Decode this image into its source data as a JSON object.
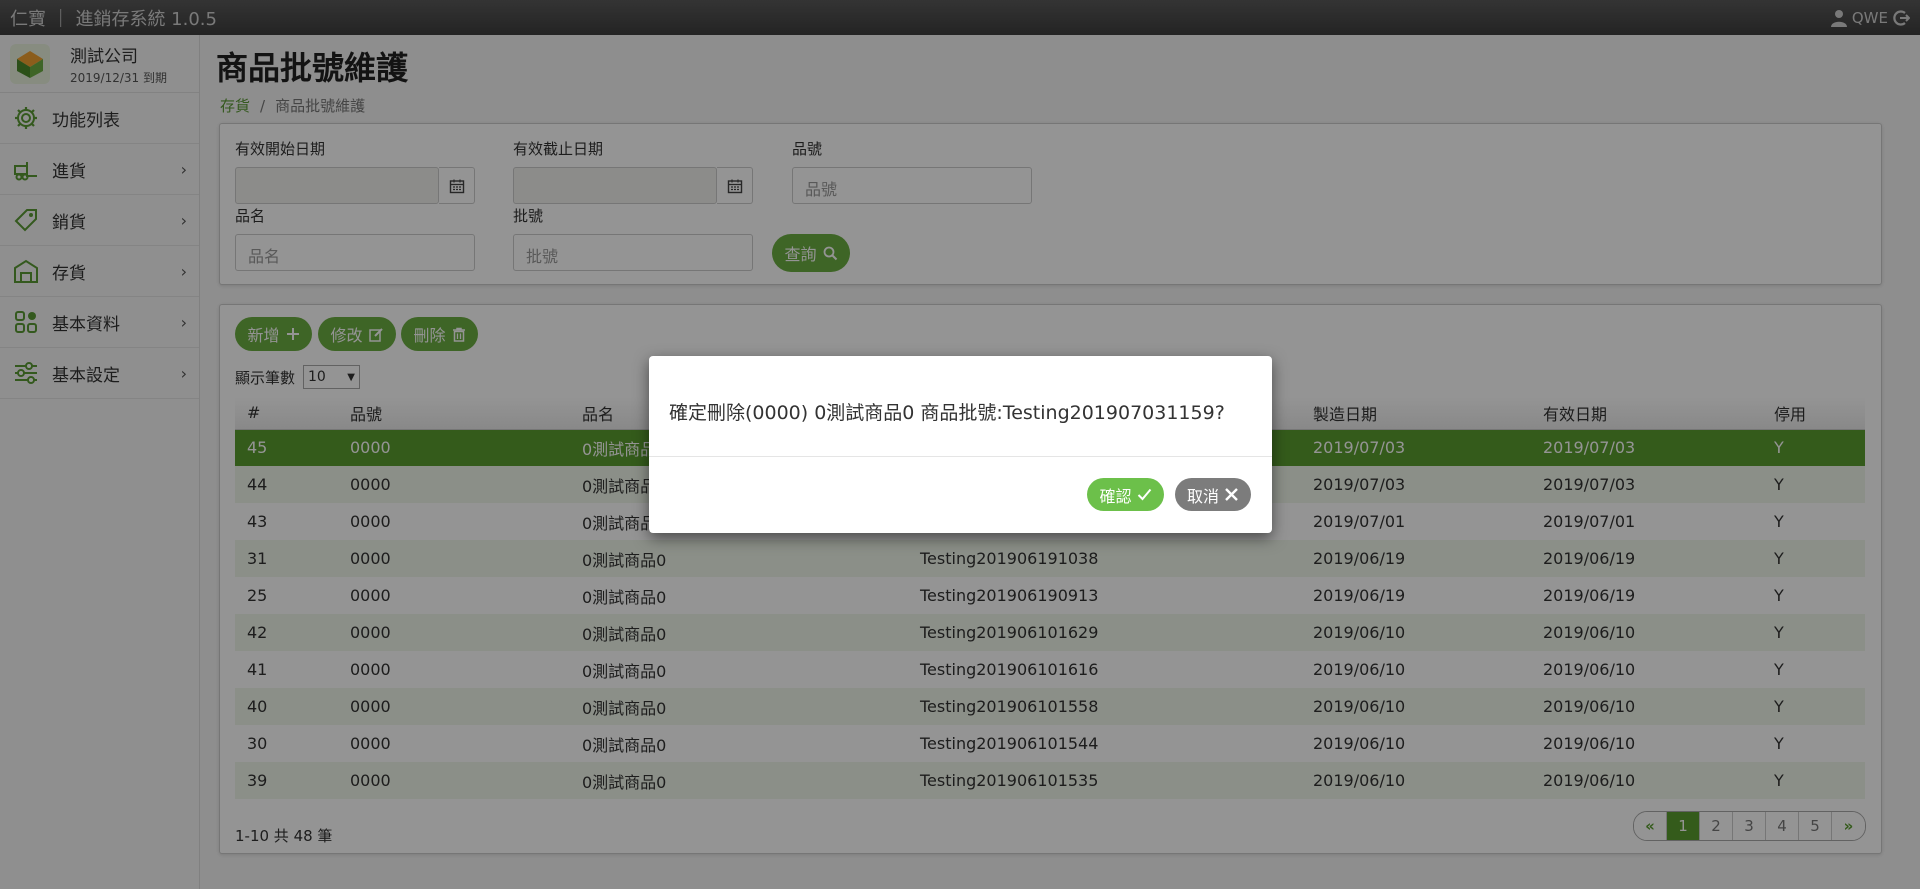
{
  "topbar": {
    "brand": "仁寶 ｜ 進銷存系統 1.0.5",
    "user": "QWE"
  },
  "company": {
    "name": "測試公司",
    "expire": "2019/12/31 到期"
  },
  "sidebar": {
    "items": [
      {
        "label": "功能列表",
        "icon": "gear-icon"
      },
      {
        "label": "進貨",
        "icon": "forklift-icon"
      },
      {
        "label": "銷貨",
        "icon": "tag-icon"
      },
      {
        "label": "存貨",
        "icon": "warehouse-icon"
      },
      {
        "label": "基本資料",
        "icon": "grid-icon"
      },
      {
        "label": "基本設定",
        "icon": "sliders-icon"
      }
    ]
  },
  "page": {
    "title": "商品批號維護",
    "breadcrumb": {
      "parent": "存貨",
      "current": "商品批號維護"
    }
  },
  "filter": {
    "start_date_label": "有效開始日期",
    "end_date_label": "有效截止日期",
    "code_label": "品號",
    "code_placeholder": "品號",
    "name_label": "品名",
    "name_placeholder": "品名",
    "batch_label": "批號",
    "batch_placeholder": "批號",
    "search_button": "查詢"
  },
  "toolbar": {
    "add": "新增",
    "edit": "修改",
    "delete": "刪除"
  },
  "pagesize": {
    "label": "顯示筆數",
    "value": "10"
  },
  "table": {
    "headers": [
      "#",
      "品號",
      "品名",
      "批號",
      "製造日期",
      "有效日期",
      "停用"
    ],
    "rows": [
      [
        "45",
        "0000",
        "0測試商品0",
        "Testing201907031159",
        "2019/07/03",
        "2019/07/03",
        "Y"
      ],
      [
        "44",
        "0000",
        "0測試商品0",
        "",
        "2019/07/03",
        "2019/07/03",
        "Y"
      ],
      [
        "43",
        "0000",
        "0測試商品0",
        "",
        "2019/07/01",
        "2019/07/01",
        "Y"
      ],
      [
        "31",
        "0000",
        "0測試商品0",
        "Testing201906191038",
        "2019/06/19",
        "2019/06/19",
        "Y"
      ],
      [
        "25",
        "0000",
        "0測試商品0",
        "Testing201906190913",
        "2019/06/19",
        "2019/06/19",
        "Y"
      ],
      [
        "42",
        "0000",
        "0測試商品0",
        "Testing201906101629",
        "2019/06/10",
        "2019/06/10",
        "Y"
      ],
      [
        "41",
        "0000",
        "0測試商品0",
        "Testing201906101616",
        "2019/06/10",
        "2019/06/10",
        "Y"
      ],
      [
        "40",
        "0000",
        "0測試商品0",
        "Testing201906101558",
        "2019/06/10",
        "2019/06/10",
        "Y"
      ],
      [
        "30",
        "0000",
        "0測試商品0",
        "Testing201906101544",
        "2019/06/10",
        "2019/06/10",
        "Y"
      ],
      [
        "39",
        "0000",
        "0測試商品0",
        "Testing201906101535",
        "2019/06/10",
        "2019/06/10",
        "Y"
      ]
    ],
    "selected_row": 0
  },
  "summary": "1-10 共 48 筆",
  "pager": {
    "first": "«",
    "pages": [
      "1",
      "2",
      "3",
      "4",
      "5"
    ],
    "last": "»",
    "active": "1"
  },
  "modal": {
    "message": "確定刪除(0000) 0測試商品0 商品批號:Testing201907031159?",
    "confirm": "確認",
    "cancel": "取消"
  },
  "colors": {
    "accent": "#6cae42",
    "selected_row": "#5a9e2f",
    "cancel": "#7c7c7c"
  }
}
